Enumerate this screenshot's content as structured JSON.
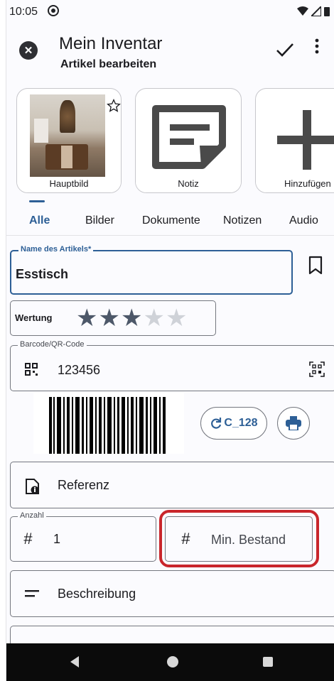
{
  "status_bar": {
    "time": "10:05"
  },
  "app_bar": {
    "title": "Mein Inventar",
    "subtitle": "Artikel bearbeiten"
  },
  "media": [
    {
      "caption": "Hauptbild",
      "favorite": true
    },
    {
      "caption": "Notiz",
      "icon": "note-icon"
    },
    {
      "caption": "Hinzufügen",
      "icon": "plus-icon"
    }
  ],
  "tabs": [
    {
      "label": "Alle",
      "active": true
    },
    {
      "label": "Bilder"
    },
    {
      "label": "Dokumente"
    },
    {
      "label": "Notizen"
    },
    {
      "label": "Audio"
    }
  ],
  "form": {
    "name_label": "Name des Artikels*",
    "name_value": "Esstisch",
    "rating_label": "Wertung",
    "rating_value": 3,
    "rating_max": 5,
    "barcode_label": "Barcode/QR-Code",
    "barcode_value": "123456",
    "barcode_type": "C_128",
    "reference_placeholder": "Referenz",
    "quantity_label": "Anzahl",
    "quantity_value": "1",
    "min_stock_placeholder": "Min. Bestand",
    "description_placeholder": "Beschreibung"
  },
  "colors": {
    "accent": "#2d5f96",
    "highlight": "#c9262b",
    "star_on": "#4d5869",
    "star_off": "#cfd2d8"
  }
}
